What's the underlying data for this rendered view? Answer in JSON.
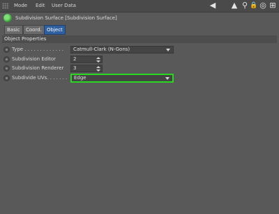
{
  "menu": {
    "items": [
      "Mode",
      "Edit",
      "User Data"
    ]
  },
  "toolbar": {
    "icons": [
      "back-arrow-icon",
      "up-arrow-icon",
      "search-icon",
      "lock-icon",
      "target-icon",
      "new-window-icon"
    ],
    "glyphs": {
      "back": "◀",
      "up": "▲",
      "search": "⚲",
      "lock": "🔒",
      "target": "◎",
      "new_window": "⊞"
    }
  },
  "title": "Subdivision Surface [Subdivision Surface]",
  "tabs": [
    {
      "label": "Basic",
      "active": false
    },
    {
      "label": "Coord.",
      "active": false
    },
    {
      "label": "Object",
      "active": true
    }
  ],
  "section": {
    "title": "Object Properties",
    "rows": [
      {
        "label": "Type . . . . . . . . . . . . .",
        "control": "dropdown",
        "value": "Catmull-Clark (N-Gons)"
      },
      {
        "label": "Subdivision Editor",
        "control": "number",
        "value": "2"
      },
      {
        "label": "Subdivision Renderer",
        "control": "number",
        "value": "3"
      },
      {
        "label": "Subdivide UVs. . . . . . .",
        "control": "dropdown",
        "value": "Edge",
        "highlighted": true
      }
    ]
  },
  "colors": {
    "background": "#595959",
    "active_tab": "#2f5f9e",
    "highlight": "#29d81f"
  }
}
